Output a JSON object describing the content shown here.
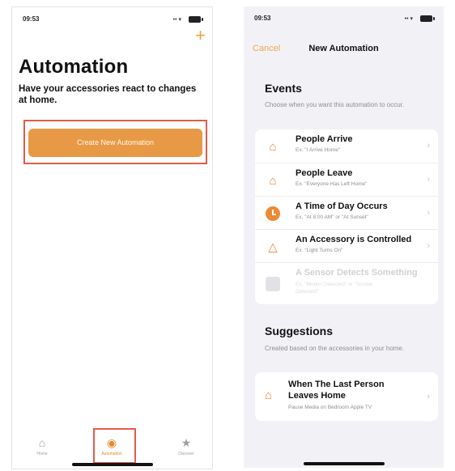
{
  "left_screen": {
    "status": {
      "time": "09:53",
      "signal": "•• ▾"
    },
    "add_symbol": "+",
    "title": "Automation",
    "subtitle": "Have your accessories react to changes at home.",
    "create_button": "Create New Automation",
    "tabs": [
      {
        "label": "Home",
        "icon": "⌂"
      },
      {
        "label": "Automation",
        "icon": "◉"
      },
      {
        "label": "Discover",
        "icon": "★"
      }
    ],
    "highlight_color": "#e35b4a",
    "accent_color": "#e79946"
  },
  "right_screen": {
    "status": {
      "time": "09:53",
      "signal": "•• ▾"
    },
    "nav": {
      "cancel": "Cancel",
      "title": "New Automation"
    },
    "events": {
      "title": "Events",
      "subtitle": "Choose when you want this automation to occur.",
      "items": [
        {
          "title": "People Arrive",
          "subtitle": "Ex. \"I Arrive Home\"",
          "icon": "house-person-icon"
        },
        {
          "title": "People Leave",
          "subtitle": "Ex. \"Everyone Has Left Home\"",
          "icon": "house-person-icon"
        },
        {
          "title": "A Time of Day Occurs",
          "subtitle": "Ex. \"At 8:00 AM\" or \"At Sunset\"",
          "icon": "clock-icon"
        },
        {
          "title": "An Accessory is Controlled",
          "subtitle": "Ex. \"Light Turns On\"",
          "icon": "accessory-icon"
        },
        {
          "title": "A Sensor Detects Something",
          "subtitle": "Ex. \"Motion Detected\" or \"Smoke Detected\"",
          "icon": "sensor-icon",
          "disabled": true
        }
      ]
    },
    "suggestions": {
      "title": "Suggestions",
      "subtitle": "Created based on the accessories in your home.",
      "items": [
        {
          "title": "When The Last Person Leaves Home",
          "subtitle": "Pause Media on Bedroom Apple TV",
          "icon": "house-person-icon"
        }
      ]
    },
    "chevron": "›"
  }
}
